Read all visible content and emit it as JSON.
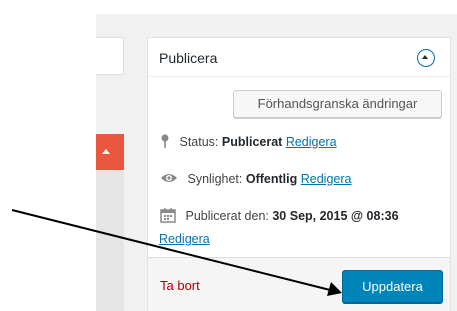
{
  "publish": {
    "title": "Publicera",
    "preview_label": "Förhandsgranska ändringar",
    "status": {
      "label": "Status:",
      "value": "Publicerat",
      "edit": "Redigera"
    },
    "visibility": {
      "label": "Synlighet:",
      "value": "Offentlig",
      "edit": "Redigera"
    },
    "published": {
      "label": "Publicerat den:",
      "value": "30 Sep, 2015 @ 08:36",
      "edit": "Redigera"
    },
    "trash_label": "Ta bort",
    "update_label": "Uppdatera"
  },
  "icons": {
    "pin": "pin-icon",
    "eye": "eye-icon",
    "calendar": "calendar-icon",
    "toggle": "chevron-up-icon",
    "collapse": "caret-up-icon"
  },
  "colors": {
    "accent": "#0085ba",
    "link": "#0073aa",
    "danger": "#a00",
    "panel_header": "#e9573f"
  }
}
